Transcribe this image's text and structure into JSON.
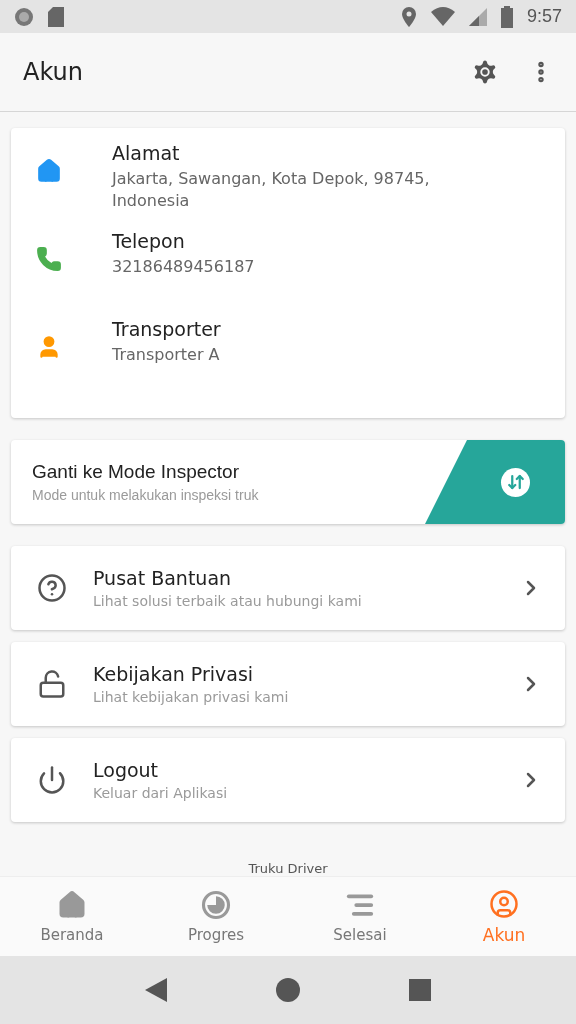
{
  "status_bar": {
    "time": "9:57"
  },
  "app_bar": {
    "title": "Akun"
  },
  "info": [
    {
      "label": "Alamat",
      "value": "Jakarta, Sawangan, Kota Depok, 98745, Indonesia",
      "color": "#2196f3"
    },
    {
      "label": "Telepon",
      "value": "32186489456187",
      "color": "#4caf50"
    },
    {
      "label": "Transporter",
      "value": "Transporter A",
      "color": "#ff9800"
    }
  ],
  "mode_switch": {
    "title": "Ganti ke Mode Inspector",
    "subtitle": "Mode untuk melakukan inspeksi truk"
  },
  "menu": [
    {
      "title": "Pusat Bantuan",
      "subtitle": "Lihat solusi terbaik atau hubungi kami"
    },
    {
      "title": "Kebijakan Privasi",
      "subtitle": "Lihat kebijakan privasi kami"
    },
    {
      "title": "Logout",
      "subtitle": "Keluar dari Aplikasi"
    }
  ],
  "footer": {
    "app_name": "Truku Driver"
  },
  "bottom_nav": [
    {
      "label": "Beranda",
      "selected": false
    },
    {
      "label": "Progres",
      "selected": false
    },
    {
      "label": "Selesai",
      "selected": false
    },
    {
      "label": "Akun",
      "selected": true
    }
  ]
}
